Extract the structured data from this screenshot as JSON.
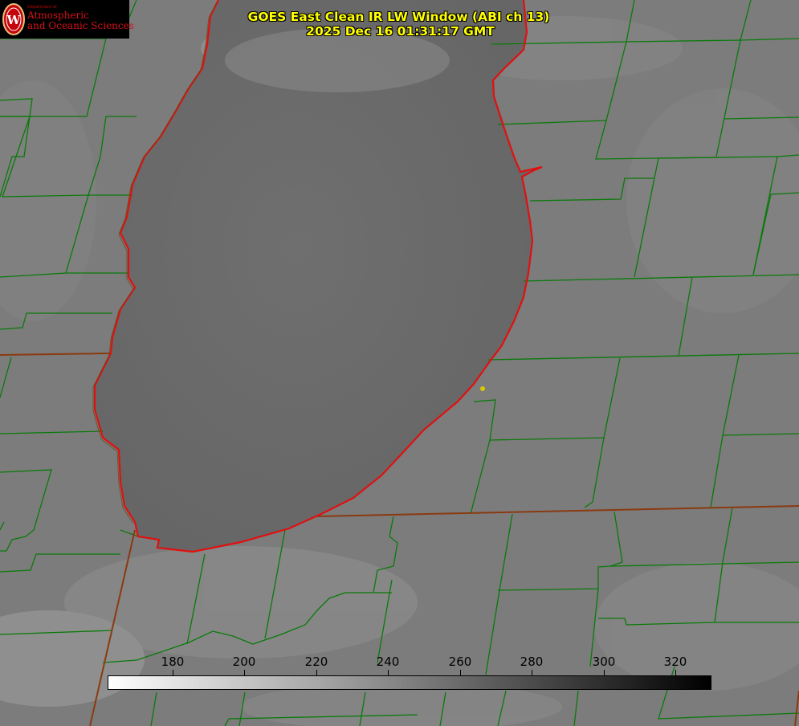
{
  "logo": {
    "department": "Department of",
    "line1": "Atmospheric",
    "line2": "and Oceanic Sciences",
    "icon": "uw-crest-icon"
  },
  "title": {
    "line1": "GOES East Clean IR LW Window (ABI ch 13)",
    "line2": "2025 Dec 16 01:31:17 GMT"
  },
  "colorbar": {
    "ticks": [
      "180",
      "200",
      "220",
      "240",
      "260",
      "280",
      "300",
      "320"
    ],
    "min": 162,
    "max": 330,
    "colormap": "white-to-black"
  },
  "colors": {
    "coastline": "#e01010",
    "state_border": "#8a3a10",
    "county_border": "#0a7a0a",
    "title_text": "#ffff00",
    "station_marker": "#d8c800"
  }
}
